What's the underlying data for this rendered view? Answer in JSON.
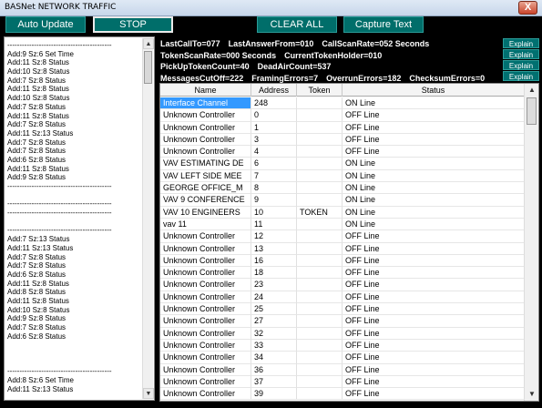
{
  "window": {
    "title": "BASNet NETWORK TRAFFIC",
    "close_glyph": "X"
  },
  "toolbar": {
    "auto_update": "Auto Update",
    "stop": "STOP",
    "clear_all": "CLEAR ALL",
    "capture_text": "Capture Text"
  },
  "log": [
    "-------------------------------------------",
    "Add:9 Sz:6 Set Time",
    "Add:11 Sz:8 Status",
    "Add:10 Sz:8 Status",
    "Add:7 Sz:8 Status",
    "Add:11 Sz:8 Status",
    "Add:10 Sz:8 Status",
    "Add:7 Sz:8 Status",
    "Add:11 Sz:8 Status",
    "Add:7 Sz:8 Status",
    "Add:11 Sz:13 Status",
    "Add:7 Sz:8 Status",
    "Add:7 Sz:8 Status",
    "Add:6 Sz:8 Status",
    "Add:11 Sz:8 Status",
    "Add:9 Sz:8 Status",
    "-------------------------------------------",
    "",
    "-------------------------------------------",
    "-------------------------------------------",
    "",
    "-------------------------------------------",
    "Add:7 Sz:13 Status",
    "Add:11 Sz:13 Status",
    "Add:7 Sz:8 Status",
    "Add:7 Sz:8 Status",
    "Add:6 Sz:8 Status",
    "Add:11 Sz:8 Status",
    "Add:8 Sz:8 Status",
    "Add:11 Sz:8 Status",
    "Add:10 Sz:8 Status",
    "Add:9 Sz:8 Status",
    "Add:7 Sz:8 Status",
    "Add:6 Sz:8 Status",
    "",
    "",
    "",
    "-------------------------------------------",
    "Add:8 Sz:6 Set Time",
    "Add:11 Sz:13 Status"
  ],
  "stats": {
    "line1": [
      "LastCallTo=077",
      "LastAnswerFrom=010",
      "CallScanRate=052 Seconds"
    ],
    "line2": [
      "TokenScanRate=000 Seconds",
      "CurrentTokenHolder=010"
    ],
    "line3": [
      "PickUpTokenCount=40",
      "DeadAirCount=537"
    ],
    "line4": [
      "MessagesCutOff=222",
      "FramingErrors=7",
      "OverrunErrors=182",
      "ChecksumErrors=0"
    ],
    "explain_label": "Explain"
  },
  "table": {
    "headers": [
      "Name",
      "Address",
      "Token",
      "Status"
    ],
    "rows": [
      [
        "Interface Channel",
        "248",
        "",
        "ON Line"
      ],
      [
        "Unknown Controller",
        "0",
        "",
        "OFF Line"
      ],
      [
        "Unknown Controller",
        "1",
        "",
        "OFF Line"
      ],
      [
        "Unknown Controller",
        "3",
        "",
        "OFF Line"
      ],
      [
        "Unknown Controller",
        "4",
        "",
        "OFF Line"
      ],
      [
        "VAV ESTIMATING DE",
        "6",
        "",
        "ON Line"
      ],
      [
        "VAV LEFT SIDE MEE",
        "7",
        "",
        "ON Line"
      ],
      [
        "GEORGE OFFICE_M",
        "8",
        "",
        "ON Line"
      ],
      [
        "VAV 9 CONFERENCE",
        "9",
        "",
        "ON Line"
      ],
      [
        "VAV 10 ENGINEERS",
        "10",
        "TOKEN",
        "ON Line"
      ],
      [
        "vav 11",
        "11",
        "",
        "ON Line"
      ],
      [
        "Unknown Controller",
        "12",
        "",
        "OFF Line"
      ],
      [
        "Unknown Controller",
        "13",
        "",
        "OFF Line"
      ],
      [
        "Unknown Controller",
        "16",
        "",
        "OFF Line"
      ],
      [
        "Unknown Controller",
        "18",
        "",
        "OFF Line"
      ],
      [
        "Unknown Controller",
        "23",
        "",
        "OFF Line"
      ],
      [
        "Unknown Controller",
        "24",
        "",
        "OFF Line"
      ],
      [
        "Unknown Controller",
        "25",
        "",
        "OFF Line"
      ],
      [
        "Unknown Controller",
        "27",
        "",
        "OFF Line"
      ],
      [
        "Unknown Controller",
        "32",
        "",
        "OFF Line"
      ],
      [
        "Unknown Controller",
        "33",
        "",
        "OFF Line"
      ],
      [
        "Unknown Controller",
        "34",
        "",
        "OFF Line"
      ],
      [
        "Unknown Controller",
        "36",
        "",
        "OFF Line"
      ],
      [
        "Unknown Controller",
        "37",
        "",
        "OFF Line"
      ],
      [
        "Unknown Controller",
        "39",
        "",
        "OFF Line"
      ]
    ]
  }
}
